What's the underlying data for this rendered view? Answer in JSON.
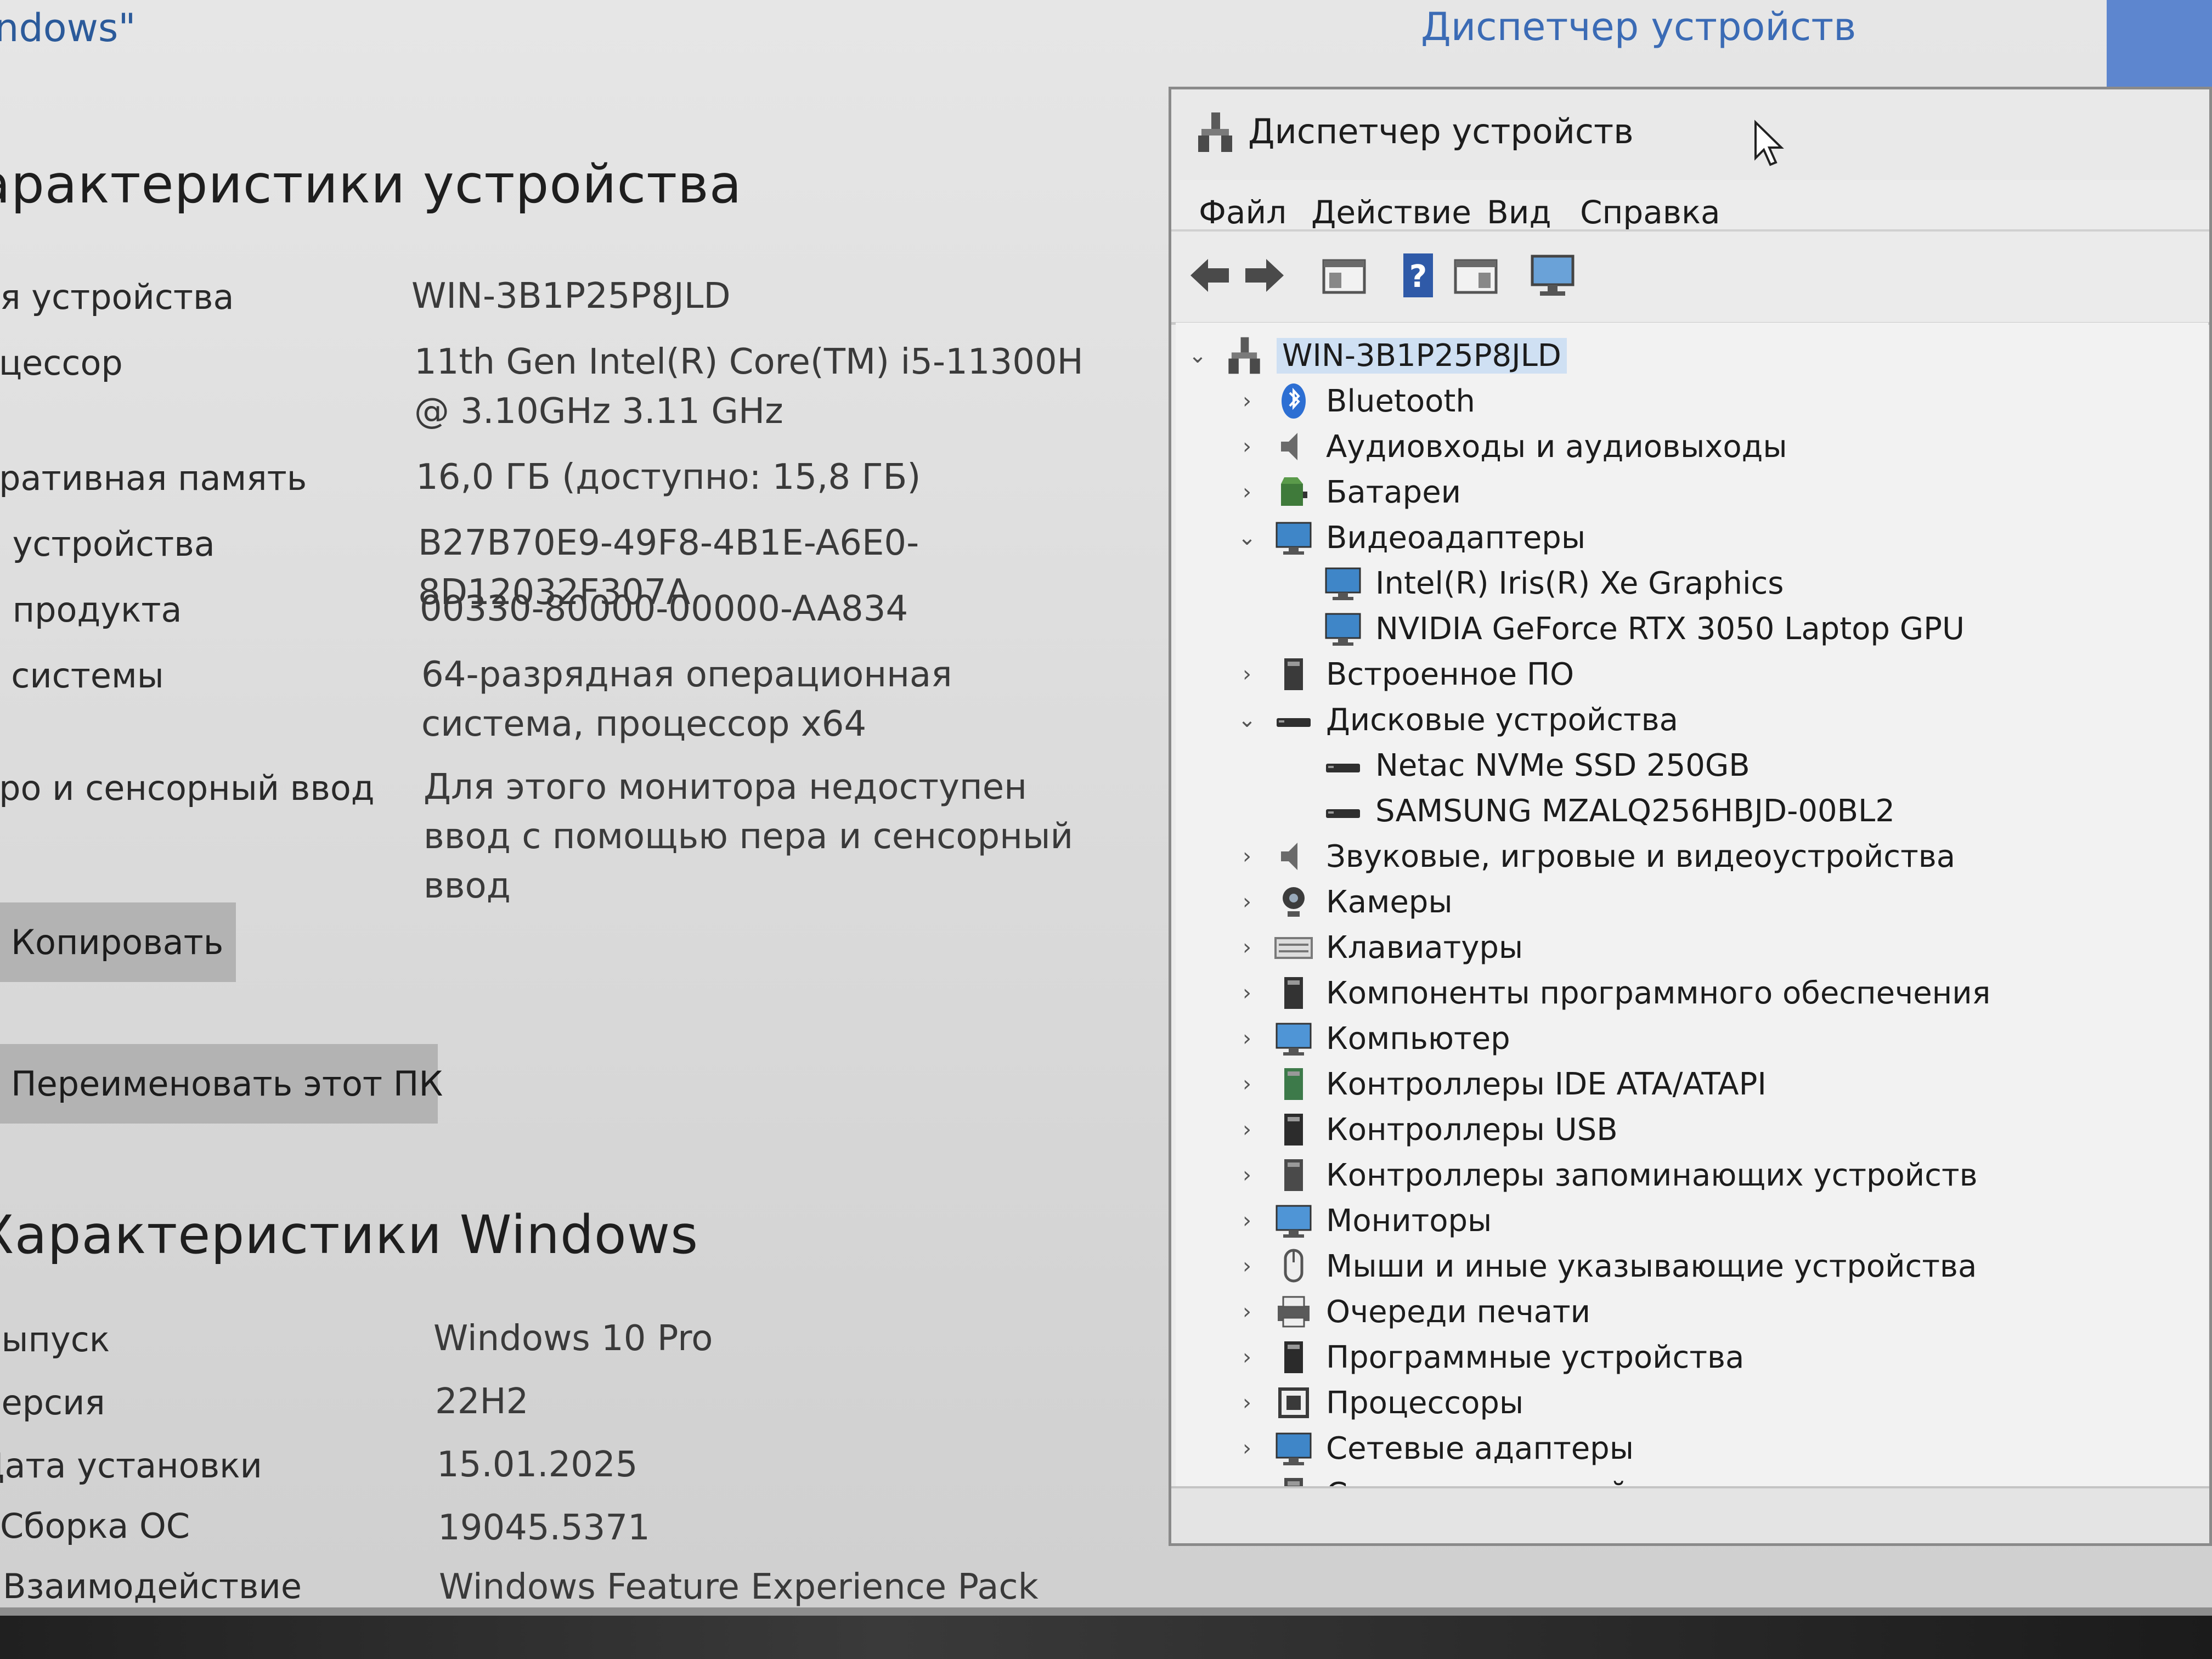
{
  "settings": {
    "top_link": "ndows\"",
    "device_specs_title": "арактеристики устройства",
    "device_specs": [
      {
        "label": "ия устройства",
        "value": "WIN-3B1P25P8JLD"
      },
      {
        "label": "оцессор",
        "value": "11th Gen Intel(R) Core(TM) i5-11300H @ 3.10GHz   3.11 GHz"
      },
      {
        "label": "еративная память",
        "value": "16,0 ГБ (доступно: 15,8 ГБ)"
      },
      {
        "label": "д устройства",
        "value": "B27B70E9-49F8-4B1E-A6E0-8D12032F307A"
      },
      {
        "label": "д продукта",
        "value": "00330-80000-00000-AA834"
      },
      {
        "label": "п системы",
        "value": "64-разрядная операционная система, процессор x64"
      },
      {
        "label": "еро и сенсорный ввод",
        "value": "Для этого монитора недоступен ввод с помощью пера и сенсорный ввод"
      }
    ],
    "copy_button": "Копировать",
    "rename_button": "Переименовать этот ПК",
    "windows_specs_title": "Характеристики Windows",
    "windows_specs": [
      {
        "label": "Выпуск",
        "value": "Windows 10 Pro"
      },
      {
        "label": "Версия",
        "value": "22H2"
      },
      {
        "label": "Дата установки",
        "value": "15.01.2025"
      },
      {
        "label": "Сборка ОС",
        "value": "19045.5371"
      },
      {
        "label": "Взаимодействие",
        "value": "Windows Feature Experience Pack"
      }
    ],
    "device_manager_link": "Диспетчер устройств"
  },
  "device_manager": {
    "title": "Диспетчер устройств",
    "menu": [
      "Файл",
      "Действие",
      "Вид",
      "Справка"
    ],
    "toolbar": [
      "back-icon",
      "forward-icon",
      "properties-icon",
      "help-icon",
      "view-icon",
      "monitor-icon"
    ],
    "root": "WIN-3B1P25P8JLD",
    "nodes": [
      {
        "label": "Bluetooth",
        "state": "collapsed",
        "level": 1,
        "icon": "bluetooth-icon"
      },
      {
        "label": "Аудиовходы и аудиовыходы",
        "state": "collapsed",
        "level": 1,
        "icon": "speaker-icon"
      },
      {
        "label": "Батареи",
        "state": "collapsed",
        "level": 1,
        "icon": "battery-icon"
      },
      {
        "label": "Видеоадаптеры",
        "state": "expanded",
        "level": 1,
        "icon": "display-adapter-icon"
      },
      {
        "label": "Intel(R) Iris(R) Xe Graphics",
        "state": "leaf",
        "level": 2,
        "icon": "display-adapter-icon"
      },
      {
        "label": "NVIDIA GeForce RTX 3050 Laptop GPU",
        "state": "leaf",
        "level": 2,
        "icon": "display-adapter-icon"
      },
      {
        "label": "Встроенное ПО",
        "state": "collapsed",
        "level": 1,
        "icon": "firmware-icon"
      },
      {
        "label": "Дисковые устройства",
        "state": "expanded",
        "level": 1,
        "icon": "disk-icon"
      },
      {
        "label": "Netac NVMe SSD 250GB",
        "state": "leaf",
        "level": 2,
        "icon": "disk-icon"
      },
      {
        "label": "SAMSUNG MZALQ256HBJD-00BL2",
        "state": "leaf",
        "level": 2,
        "icon": "disk-icon"
      },
      {
        "label": "Звуковые, игровые и видеоустройства",
        "state": "collapsed",
        "level": 1,
        "icon": "speaker-icon"
      },
      {
        "label": "Камеры",
        "state": "collapsed",
        "level": 1,
        "icon": "camera-icon"
      },
      {
        "label": "Клавиатуры",
        "state": "collapsed",
        "level": 1,
        "icon": "keyboard-icon"
      },
      {
        "label": "Компоненты программного обеспечения",
        "state": "collapsed",
        "level": 1,
        "icon": "software-component-icon"
      },
      {
        "label": "Компьютер",
        "state": "collapsed",
        "level": 1,
        "icon": "computer-icon"
      },
      {
        "label": "Контроллеры IDE ATA/ATAPI",
        "state": "collapsed",
        "level": 1,
        "icon": "ide-controller-icon"
      },
      {
        "label": "Контроллеры USB",
        "state": "collapsed",
        "level": 1,
        "icon": "usb-icon"
      },
      {
        "label": "Контроллеры запоминающих устройств",
        "state": "collapsed",
        "level": 1,
        "icon": "storage-controller-icon"
      },
      {
        "label": "Мониторы",
        "state": "collapsed",
        "level": 1,
        "icon": "monitor-icon"
      },
      {
        "label": "Мыши и иные указывающие устройства",
        "state": "collapsed",
        "level": 1,
        "icon": "mouse-icon"
      },
      {
        "label": "Очереди печати",
        "state": "collapsed",
        "level": 1,
        "icon": "printer-icon"
      },
      {
        "label": "Программные устройства",
        "state": "collapsed",
        "level": 1,
        "icon": "software-device-icon"
      },
      {
        "label": "Процессоры",
        "state": "collapsed",
        "level": 1,
        "icon": "processor-icon"
      },
      {
        "label": "Сетевые адаптеры",
        "state": "collapsed",
        "level": 1,
        "icon": "network-adapter-icon"
      },
      {
        "label": "Системные устройства",
        "state": "collapsed",
        "level": 1,
        "icon": "system-device-icon"
      }
    ]
  }
}
